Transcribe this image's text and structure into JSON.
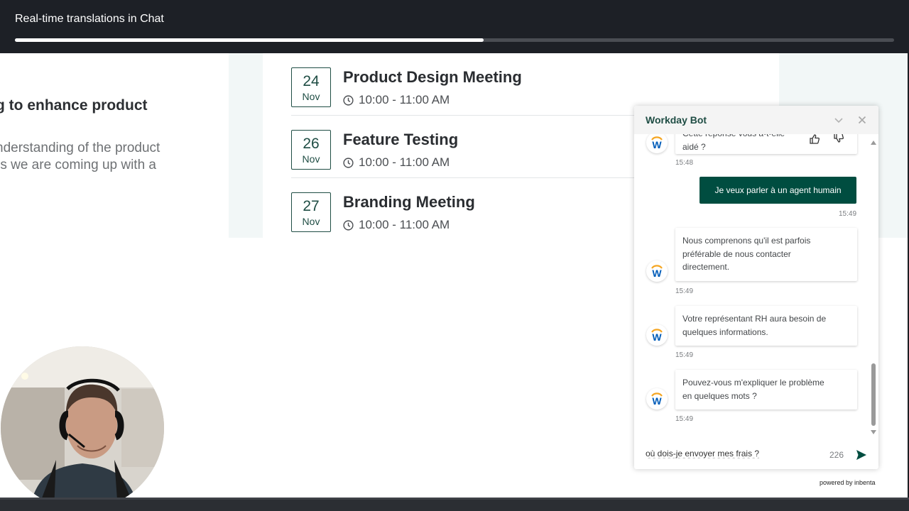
{
  "video": {
    "title": "Real-time translations in Chat",
    "progress_percent": 53.3
  },
  "page": {
    "left_heading": "g to enhance product",
    "left_body_line1": "nderstanding of the product",
    "left_body_line2": "rs we are coming up with a"
  },
  "events": [
    {
      "day": "24",
      "month": "Nov",
      "title": "Product Design Meeting",
      "time": "10:00 - 11:00 AM"
    },
    {
      "day": "26",
      "month": "Nov",
      "title": "Feature Testing",
      "time": "10:00 - 11:00 AM"
    },
    {
      "day": "27",
      "month": "Nov",
      "title": "Branding Meeting",
      "time": "10:00 - 11:00 AM"
    }
  ],
  "chat": {
    "title": "Workday Bot",
    "feedback_question_line1": "Cette réponse vous a-t-elle",
    "feedback_question_line2": "aidé ?",
    "feedback_time": "15:48",
    "user_message": "Je veux parler à un agent humain",
    "user_time": "15:49",
    "bot_messages": [
      {
        "line1": "Nous comprenons qu'il est parfois",
        "line2": "préférable de nous contacter",
        "line3": "directement.",
        "time": "15:49"
      },
      {
        "line1": "Votre représentant RH aura besoin de",
        "line2": "quelques informations.",
        "time": "15:49"
      },
      {
        "line1": "Pouvez-vous m'expliquer le problème",
        "line2": "en quelques mots ?",
        "time": "15:49"
      }
    ],
    "input_value": "où dois-je envoyer mes frais ?",
    "char_count": "226",
    "powered_by": "powered by inbenta",
    "brand_color": "#004d40"
  },
  "icons": {
    "clock": "clock-icon",
    "minimize": "chevron-down-icon",
    "close": "close-icon",
    "thumbs_up": "thumbs-up-icon",
    "thumbs_down": "thumbs-down-icon",
    "send": "send-icon",
    "avatar": "workday-logo-icon"
  }
}
